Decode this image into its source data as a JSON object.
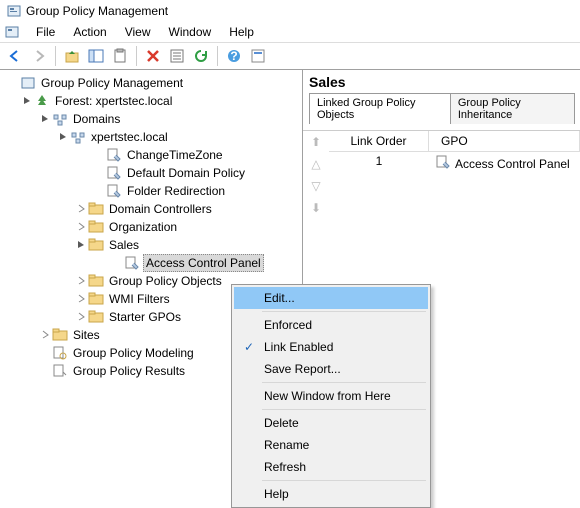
{
  "window": {
    "title": "Group Policy Management"
  },
  "menubar": {
    "file": "File",
    "action": "Action",
    "view": "View",
    "window": "Window",
    "help": "Help"
  },
  "tree": {
    "root": "Group Policy Management",
    "forest": "Forest: xpertstec.local",
    "domains": "Domains",
    "domain": "xpertstec.local",
    "changetimezone": "ChangeTimeZone",
    "defaultdomainpolicy": "Default Domain Policy",
    "folderredirection": "Folder Redirection",
    "domaincontrollers": "Domain Controllers",
    "organization": "Organization",
    "sales": "Sales",
    "accesscontrolpanel": "Access Control Panel",
    "grouppolicyobjects": "Group Policy Objects",
    "wmifilters": "WMI Filters",
    "startergpos": "Starter GPOs",
    "sites": "Sites",
    "gpmodeling": "Group Policy Modeling",
    "gpresults": "Group Policy Results"
  },
  "detail": {
    "heading": "Sales",
    "tab1": "Linked Group Policy Objects",
    "tab2": "Group Policy Inheritance",
    "col1": "Link Order",
    "col2": "GPO",
    "row1_order": "1",
    "row1_gpo": "Access Control Panel"
  },
  "contextmenu": {
    "edit": "Edit...",
    "enforced": "Enforced",
    "linkenabled": "Link Enabled",
    "savereport": "Save Report...",
    "newwindow": "New Window from Here",
    "delete": "Delete",
    "rename": "Rename",
    "refresh": "Refresh",
    "help": "Help"
  }
}
